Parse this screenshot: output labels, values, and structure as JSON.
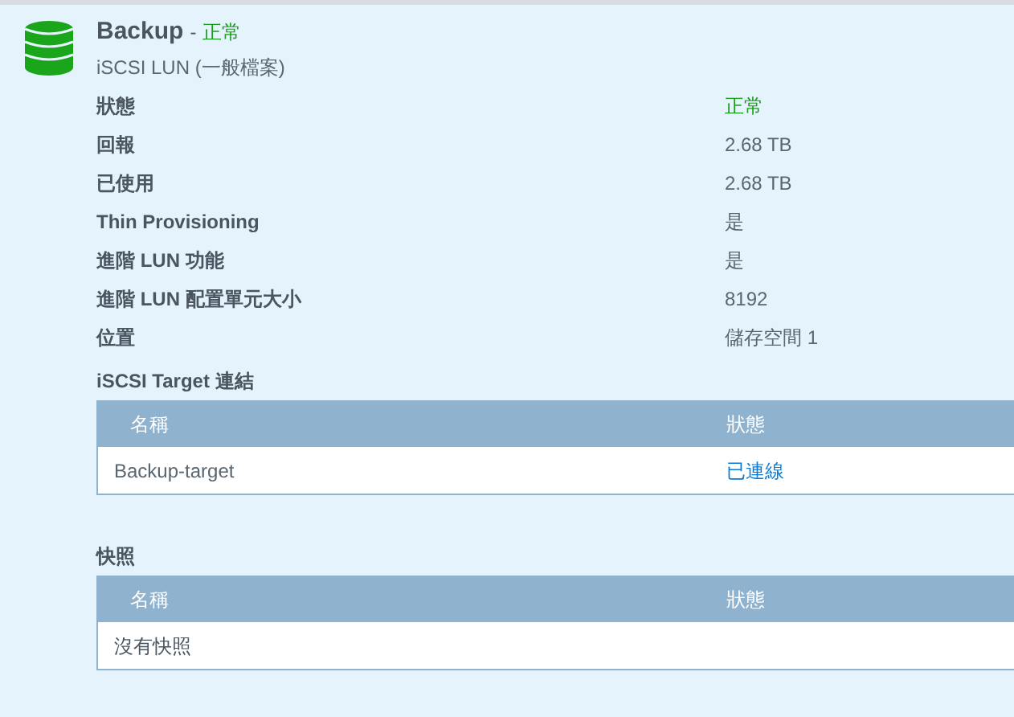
{
  "header": {
    "title": "Backup",
    "separator": "-",
    "status": "正常",
    "subtitle": "iSCSI LUN (一般檔案)"
  },
  "properties": [
    {
      "label": "狀態",
      "value": "正常",
      "kind": "status"
    },
    {
      "label": "回報",
      "value": "2.68 TB",
      "kind": "plain"
    },
    {
      "label": "已使用",
      "value": "2.68 TB",
      "kind": "plain"
    },
    {
      "label": "Thin Provisioning",
      "value": "是",
      "kind": "plain"
    },
    {
      "label": "進階 LUN 功能",
      "value": "是",
      "kind": "plain"
    },
    {
      "label": "進階 LUN 配置單元大小",
      "value": "8192",
      "kind": "plain"
    },
    {
      "label": "位置",
      "value": "儲存空間 1",
      "kind": "plain"
    }
  ],
  "sections": [
    {
      "title": "iSCSI Target 連結",
      "columns": [
        "名稱",
        "狀態"
      ],
      "rows": [
        {
          "name": "Backup-target",
          "status": "已連線",
          "kind": "link"
        }
      ]
    },
    {
      "title": "快照",
      "columns": [
        "名稱",
        "狀態"
      ],
      "rows": [
        {
          "name": "沒有快照",
          "kind": "empty"
        }
      ]
    }
  ]
}
